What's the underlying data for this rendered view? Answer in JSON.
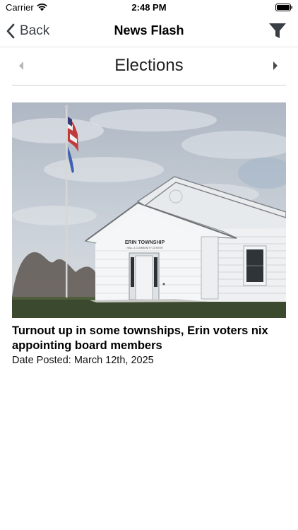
{
  "status_bar": {
    "carrier": "Carrier",
    "time": "2:48 PM",
    "icons": [
      "wifi-icon",
      "battery-icon"
    ]
  },
  "nav": {
    "back_label": "Back",
    "title": "News Flash",
    "back_icon": "chevron-left-icon",
    "filter_icon": "filter-icon"
  },
  "category": {
    "label": "Elections",
    "prev_icon": "triangle-left-icon",
    "next_icon": "triangle-right-icon"
  },
  "article": {
    "title": "Turnout up in some townships, Erin voters nix appointing board members",
    "date": "Date Posted: March 12th, 2025",
    "image_sign": "ERIN TOWNSHIP",
    "image_sign_sub": "HALL & COMMUNITY CENTER"
  },
  "colors": {
    "text": "#000000",
    "icon": "#3a3f45",
    "divider": "#cfcfcf"
  }
}
